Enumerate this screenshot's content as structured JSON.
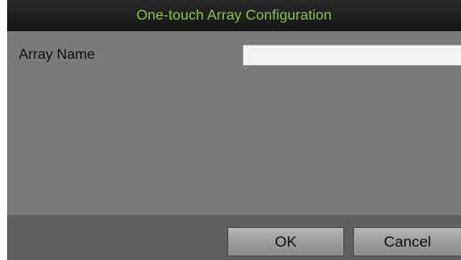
{
  "dialog": {
    "title": "One-touch Array Configuration",
    "title_color": "#8dc63f"
  },
  "form": {
    "array_name_label": "Array Name",
    "array_name_value": "",
    "array_name_placeholder": ""
  },
  "footer": {
    "ok_label": "OK",
    "cancel_label": "Cancel"
  }
}
